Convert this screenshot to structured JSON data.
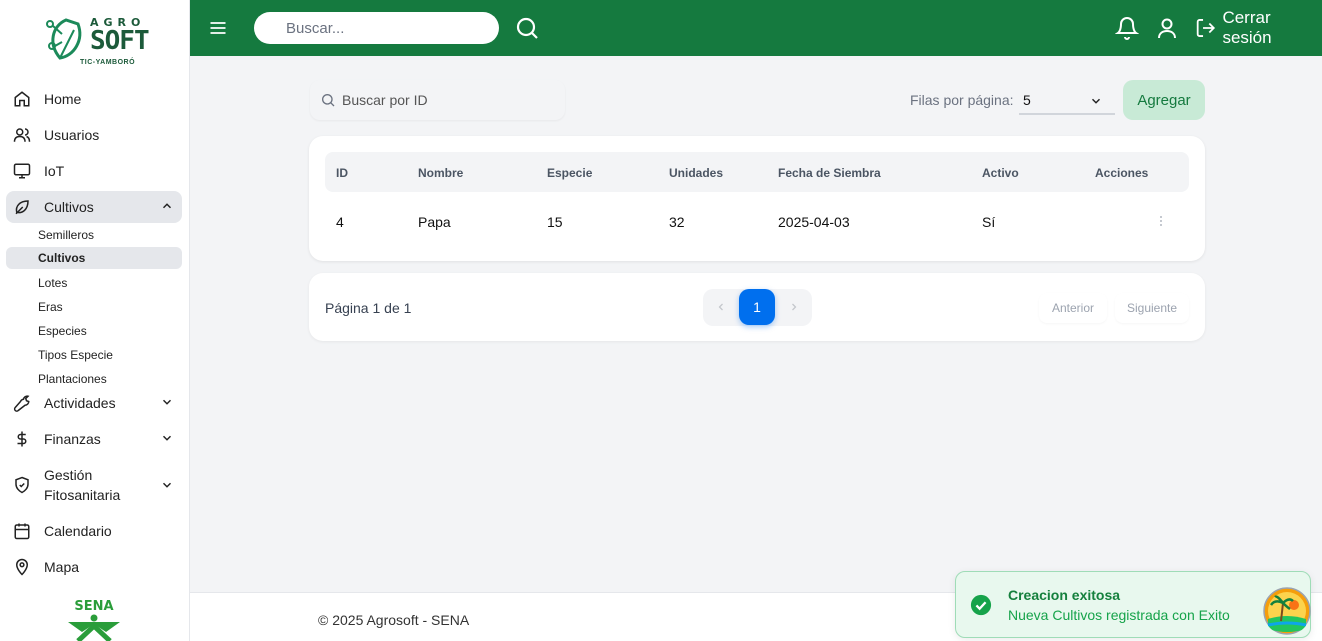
{
  "brand": {
    "logo_agro": "AGRO",
    "logo_soft": "SOFT",
    "logo_tagline": "TIC-YAMBORÓ",
    "sena_logo_text": "SENA"
  },
  "header": {
    "search_placeholder": "Buscar...",
    "logout_label": "Cerrar sesión"
  },
  "sidebar": {
    "items": [
      {
        "label": "Home",
        "icon": "home-icon"
      },
      {
        "label": "Usuarios",
        "icon": "users-icon"
      },
      {
        "label": "IoT",
        "icon": "monitor-icon"
      },
      {
        "label": "Cultivos",
        "icon": "leaf-icon",
        "expanded": true
      },
      {
        "label": "Actividades",
        "icon": "wrench-icon"
      },
      {
        "label": "Finanzas",
        "icon": "dollar-icon"
      },
      {
        "label": "Gestión Fitosanitaria",
        "label_line1": "Gestión",
        "label_line2": "Fitosanitaria",
        "icon": "shield-check-icon"
      },
      {
        "label": "Calendario",
        "icon": "calendar-icon"
      },
      {
        "label": "Mapa",
        "icon": "map-pin-icon"
      }
    ],
    "cultivos_sub": [
      "Semilleros",
      "Cultivos",
      "Lotes",
      "Eras",
      "Especies",
      "Tipos Especie",
      "Plantaciones"
    ],
    "active_sub": "Cultivos"
  },
  "toolbar": {
    "id_search_placeholder": "Buscar por ID",
    "rows_label": "Filas por página:",
    "rows_value": "5",
    "add_label": "Agregar"
  },
  "table": {
    "columns": [
      "ID",
      "Nombre",
      "Especie",
      "Unidades",
      "Fecha de Siembra",
      "Activo",
      "Acciones"
    ],
    "rows": [
      {
        "id": "4",
        "nombre": "Papa",
        "especie": "15",
        "unidades": "32",
        "fecha": "2025-04-03",
        "activo": "Sí"
      }
    ]
  },
  "pagination": {
    "info": "Página 1 de 1",
    "current": "1",
    "prev_label": "Anterior",
    "next_label": "Siguiente"
  },
  "footer": {
    "copyright": "© 2025 Agrosoft - SENA"
  },
  "toast": {
    "title": "Creacion exitosa",
    "message": "Nueva Cultivos registrada con Exito"
  },
  "colors": {
    "header_green": "#157a3f",
    "add_button_bg": "#c8ead6",
    "pager_active": "#006fee",
    "toast_bg": "#e8f8ee"
  }
}
